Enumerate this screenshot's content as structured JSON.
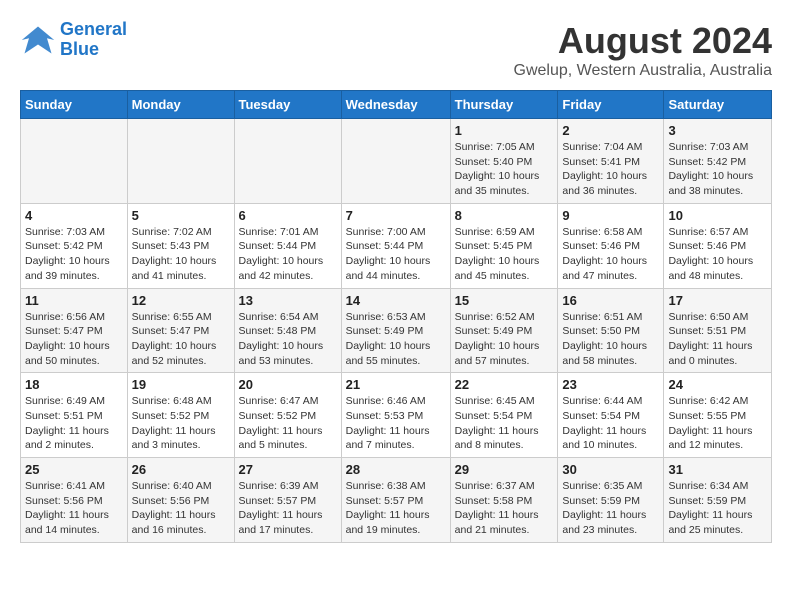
{
  "logo": {
    "line1": "General",
    "line2": "Blue"
  },
  "title": "August 2024",
  "subtitle": "Gwelup, Western Australia, Australia",
  "days_of_week": [
    "Sunday",
    "Monday",
    "Tuesday",
    "Wednesday",
    "Thursday",
    "Friday",
    "Saturday"
  ],
  "weeks": [
    [
      {
        "day": "",
        "info": ""
      },
      {
        "day": "",
        "info": ""
      },
      {
        "day": "",
        "info": ""
      },
      {
        "day": "",
        "info": ""
      },
      {
        "day": "1",
        "info": "Sunrise: 7:05 AM\nSunset: 5:40 PM\nDaylight: 10 hours\nand 35 minutes."
      },
      {
        "day": "2",
        "info": "Sunrise: 7:04 AM\nSunset: 5:41 PM\nDaylight: 10 hours\nand 36 minutes."
      },
      {
        "day": "3",
        "info": "Sunrise: 7:03 AM\nSunset: 5:42 PM\nDaylight: 10 hours\nand 38 minutes."
      }
    ],
    [
      {
        "day": "4",
        "info": "Sunrise: 7:03 AM\nSunset: 5:42 PM\nDaylight: 10 hours\nand 39 minutes."
      },
      {
        "day": "5",
        "info": "Sunrise: 7:02 AM\nSunset: 5:43 PM\nDaylight: 10 hours\nand 41 minutes."
      },
      {
        "day": "6",
        "info": "Sunrise: 7:01 AM\nSunset: 5:44 PM\nDaylight: 10 hours\nand 42 minutes."
      },
      {
        "day": "7",
        "info": "Sunrise: 7:00 AM\nSunset: 5:44 PM\nDaylight: 10 hours\nand 44 minutes."
      },
      {
        "day": "8",
        "info": "Sunrise: 6:59 AM\nSunset: 5:45 PM\nDaylight: 10 hours\nand 45 minutes."
      },
      {
        "day": "9",
        "info": "Sunrise: 6:58 AM\nSunset: 5:46 PM\nDaylight: 10 hours\nand 47 minutes."
      },
      {
        "day": "10",
        "info": "Sunrise: 6:57 AM\nSunset: 5:46 PM\nDaylight: 10 hours\nand 48 minutes."
      }
    ],
    [
      {
        "day": "11",
        "info": "Sunrise: 6:56 AM\nSunset: 5:47 PM\nDaylight: 10 hours\nand 50 minutes."
      },
      {
        "day": "12",
        "info": "Sunrise: 6:55 AM\nSunset: 5:47 PM\nDaylight: 10 hours\nand 52 minutes."
      },
      {
        "day": "13",
        "info": "Sunrise: 6:54 AM\nSunset: 5:48 PM\nDaylight: 10 hours\nand 53 minutes."
      },
      {
        "day": "14",
        "info": "Sunrise: 6:53 AM\nSunset: 5:49 PM\nDaylight: 10 hours\nand 55 minutes."
      },
      {
        "day": "15",
        "info": "Sunrise: 6:52 AM\nSunset: 5:49 PM\nDaylight: 10 hours\nand 57 minutes."
      },
      {
        "day": "16",
        "info": "Sunrise: 6:51 AM\nSunset: 5:50 PM\nDaylight: 10 hours\nand 58 minutes."
      },
      {
        "day": "17",
        "info": "Sunrise: 6:50 AM\nSunset: 5:51 PM\nDaylight: 11 hours\nand 0 minutes."
      }
    ],
    [
      {
        "day": "18",
        "info": "Sunrise: 6:49 AM\nSunset: 5:51 PM\nDaylight: 11 hours\nand 2 minutes."
      },
      {
        "day": "19",
        "info": "Sunrise: 6:48 AM\nSunset: 5:52 PM\nDaylight: 11 hours\nand 3 minutes."
      },
      {
        "day": "20",
        "info": "Sunrise: 6:47 AM\nSunset: 5:52 PM\nDaylight: 11 hours\nand 5 minutes."
      },
      {
        "day": "21",
        "info": "Sunrise: 6:46 AM\nSunset: 5:53 PM\nDaylight: 11 hours\nand 7 minutes."
      },
      {
        "day": "22",
        "info": "Sunrise: 6:45 AM\nSunset: 5:54 PM\nDaylight: 11 hours\nand 8 minutes."
      },
      {
        "day": "23",
        "info": "Sunrise: 6:44 AM\nSunset: 5:54 PM\nDaylight: 11 hours\nand 10 minutes."
      },
      {
        "day": "24",
        "info": "Sunrise: 6:42 AM\nSunset: 5:55 PM\nDaylight: 11 hours\nand 12 minutes."
      }
    ],
    [
      {
        "day": "25",
        "info": "Sunrise: 6:41 AM\nSunset: 5:56 PM\nDaylight: 11 hours\nand 14 minutes."
      },
      {
        "day": "26",
        "info": "Sunrise: 6:40 AM\nSunset: 5:56 PM\nDaylight: 11 hours\nand 16 minutes."
      },
      {
        "day": "27",
        "info": "Sunrise: 6:39 AM\nSunset: 5:57 PM\nDaylight: 11 hours\nand 17 minutes."
      },
      {
        "day": "28",
        "info": "Sunrise: 6:38 AM\nSunset: 5:57 PM\nDaylight: 11 hours\nand 19 minutes."
      },
      {
        "day": "29",
        "info": "Sunrise: 6:37 AM\nSunset: 5:58 PM\nDaylight: 11 hours\nand 21 minutes."
      },
      {
        "day": "30",
        "info": "Sunrise: 6:35 AM\nSunset: 5:59 PM\nDaylight: 11 hours\nand 23 minutes."
      },
      {
        "day": "31",
        "info": "Sunrise: 6:34 AM\nSunset: 5:59 PM\nDaylight: 11 hours\nand 25 minutes."
      }
    ]
  ]
}
